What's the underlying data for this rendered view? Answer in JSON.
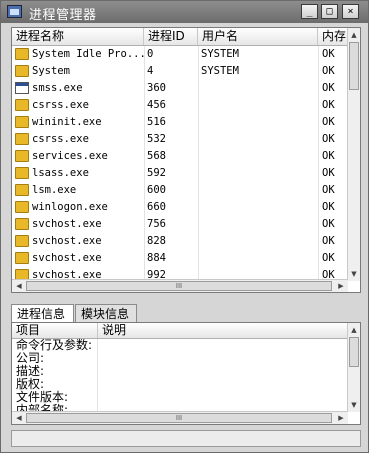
{
  "window": {
    "title": "进程管理器",
    "minimize_glyph": "_",
    "maximize_glyph": "□",
    "close_glyph": "×"
  },
  "process_list": {
    "columns": [
      "进程名称",
      "进程ID",
      "用户名",
      "内存"
    ],
    "rows": [
      {
        "icon": "folder-icon",
        "name": "System Idle Pro...",
        "pid": "0",
        "user": "SYSTEM",
        "mem": "OK"
      },
      {
        "icon": "folder-icon",
        "name": "System",
        "pid": "4",
        "user": "SYSTEM",
        "mem": "OK"
      },
      {
        "icon": "exe-icon",
        "name": "smss.exe",
        "pid": "360",
        "user": "",
        "mem": "OK"
      },
      {
        "icon": "folder-icon",
        "name": "csrss.exe",
        "pid": "456",
        "user": "",
        "mem": "OK"
      },
      {
        "icon": "folder-icon",
        "name": "wininit.exe",
        "pid": "516",
        "user": "",
        "mem": "OK"
      },
      {
        "icon": "folder-icon",
        "name": "csrss.exe",
        "pid": "532",
        "user": "",
        "mem": "OK"
      },
      {
        "icon": "folder-icon",
        "name": "services.exe",
        "pid": "568",
        "user": "",
        "mem": "OK"
      },
      {
        "icon": "folder-icon",
        "name": "lsass.exe",
        "pid": "592",
        "user": "",
        "mem": "OK"
      },
      {
        "icon": "folder-icon",
        "name": "lsm.exe",
        "pid": "600",
        "user": "",
        "mem": "OK"
      },
      {
        "icon": "folder-icon",
        "name": "winlogon.exe",
        "pid": "660",
        "user": "",
        "mem": "OK"
      },
      {
        "icon": "folder-icon",
        "name": "svchost.exe",
        "pid": "756",
        "user": "",
        "mem": "OK"
      },
      {
        "icon": "folder-icon",
        "name": "svchost.exe",
        "pid": "828",
        "user": "",
        "mem": "OK"
      },
      {
        "icon": "folder-icon",
        "name": "svchost.exe",
        "pid": "884",
        "user": "",
        "mem": "OK"
      },
      {
        "icon": "folder-icon",
        "name": "svchost.exe",
        "pid": "992",
        "user": "",
        "mem": "OK"
      }
    ],
    "hscroll_thumb_glyph": "III"
  },
  "tabs": [
    {
      "label": "进程信息",
      "active": true
    },
    {
      "label": "模块信息",
      "active": false
    }
  ],
  "info_panel": {
    "columns": [
      "项目",
      "说明"
    ],
    "rows": [
      "命令行及参数:",
      "公司:",
      "描述:",
      "版权:",
      "文件版本:",
      "内部名称:"
    ],
    "hscroll_thumb_glyph": "III"
  },
  "colors": {
    "titlebar": "#7d7d7d",
    "folder": "#e8b828",
    "window_bg": "#d6d6d6"
  }
}
